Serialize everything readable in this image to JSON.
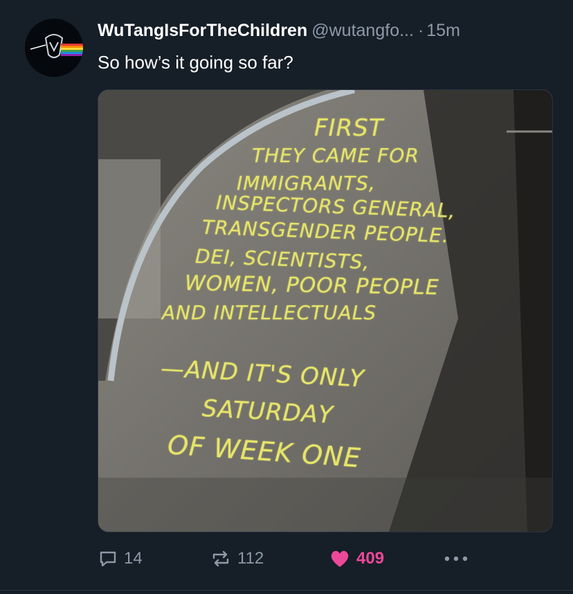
{
  "post": {
    "display_name": "WuTangIsForTheChildren",
    "handle": "@wutangfo...",
    "separator": "·",
    "time": "15m",
    "text": "So how’s it going so far?",
    "avatar_icon": "wu-tang-prism-icon",
    "image": {
      "chalk_lines": [
        "FIRST",
        "THEY CAME FOR",
        "IMMIGRANTS,",
        "INSPECTORS GENERAL,",
        "TRANSGENDER PEOPLE.",
        "DEI, SCIENTISTS,",
        "WOMEN, POOR PEOPLE",
        "AND INTELLECTUALS",
        "—AND IT'S ONLY",
        "SATURDAY",
        "OF WEEK ONE"
      ]
    }
  },
  "actions": {
    "reply_count": "14",
    "repost_count": "112",
    "like_count": "409",
    "reply_icon": "comment-icon",
    "repost_icon": "repost-icon",
    "like_icon": "heart-icon",
    "more_icon": "more-icon",
    "like_color": "#ec4899"
  },
  "colors": {
    "background": "#161e27",
    "muted": "#8d9aa8",
    "chalk": "#e7e56a"
  }
}
